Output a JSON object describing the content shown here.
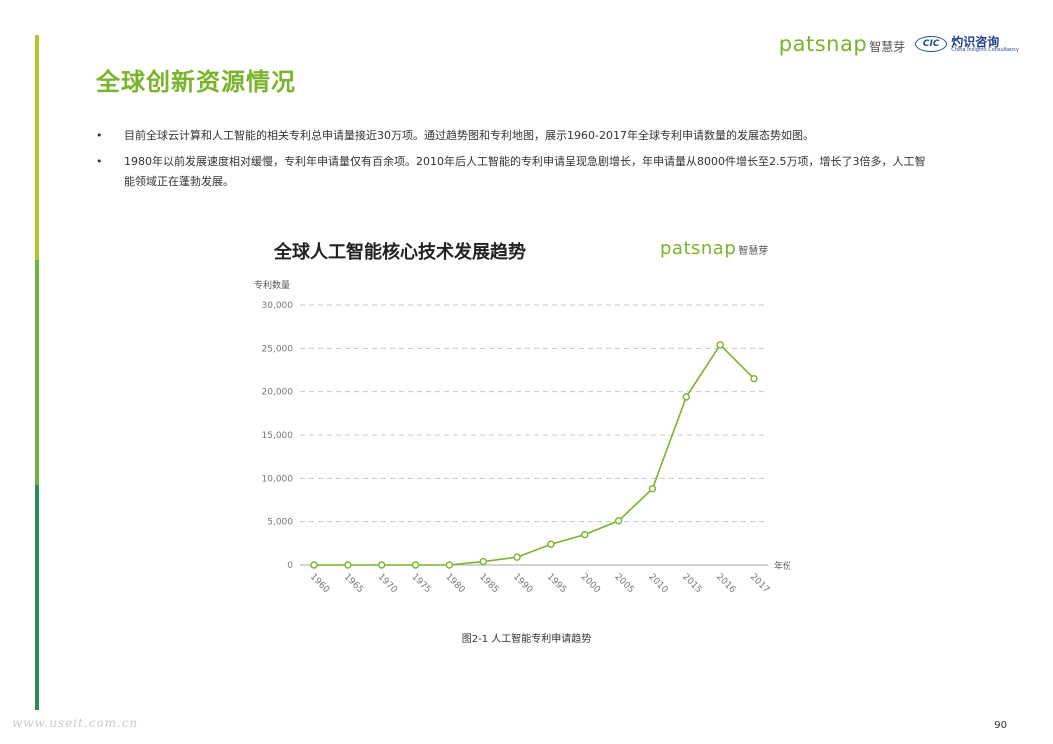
{
  "page": {
    "title": "全球创新资源情况",
    "logo_patsnap": "patsnap",
    "logo_patsnap_cn": "智慧芽",
    "logo_cic_mark": "CIC",
    "logo_cic_cn": "灼识咨询",
    "logo_cic_en": "China Insights Consultancy",
    "bullet_symbol": "•",
    "bullets": [
      "目前全球云计算和人工智能的相关专利总申请量接近30万项。通过趋势图和专利地图，展示1960-2017年全球专利申请数量的发展态势如图。",
      "1980年以前发展速度相对缓慢，专利年申请量仅有百余项。2010年后人工智能的专利申请呈现急剧增长，年申请量从8000件增长至2.5万项，增长了3倍多，人工智能领域正在蓬勃发展。"
    ],
    "caption": "图2-1 人工智能专利申请趋势",
    "watermark": "www.useit.com.cn",
    "page_number": "90"
  },
  "colors": {
    "accent": "#7ab42a",
    "line": "#7ab42a",
    "grid": "#c8c8c8"
  },
  "chart_data": {
    "type": "line",
    "title": "全球人工智能核心技术发展趋势",
    "logo": "patsnap",
    "logo_cn": "智慧芽",
    "ylabel": "专利数量",
    "xlabel": "年份",
    "ylim": [
      0,
      30000
    ],
    "yticks": [
      0,
      5000,
      10000,
      15000,
      20000,
      25000,
      30000
    ],
    "ytick_labels": [
      "0",
      "5,000",
      "10,000",
      "15,000",
      "20,000",
      "25,000",
      "30,000"
    ],
    "grid": true,
    "categories": [
      "1960",
      "1965",
      "1970",
      "1975",
      "1980",
      "1985",
      "1990",
      "1995",
      "2000",
      "2005",
      "2010",
      "2015",
      "2016",
      "2017"
    ],
    "series": [
      {
        "values": [
          0,
          0,
          0,
          0,
          0,
          400,
          900,
          2400,
          3500,
          5100,
          8800,
          19400,
          25400,
          21500
        ]
      }
    ]
  }
}
